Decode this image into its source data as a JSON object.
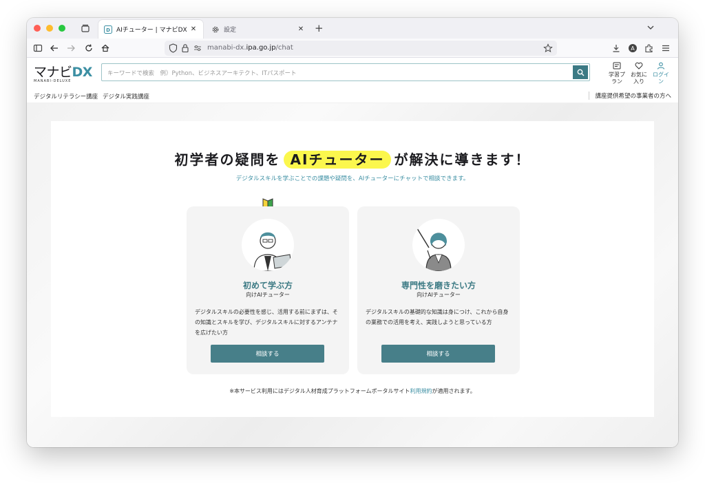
{
  "browser": {
    "tabs": [
      {
        "title": "AIチューター | マナビDX",
        "active": true
      },
      {
        "title": "設定",
        "active": false
      }
    ],
    "url": {
      "prefix": "manabi-dx.",
      "domain": "ipa.go.jp",
      "path": "/chat"
    }
  },
  "site": {
    "logo": {
      "main": "マナビ",
      "dx": "DX",
      "sub": "MANABI-DELUXE"
    },
    "search_placeholder": "キーワードで検索　例）Python、ビジネスアーキテクト、ITパスポート",
    "header_items": [
      {
        "label1": "学習プ",
        "label2": "ラン",
        "icon": "plan-icon"
      },
      {
        "label1": "お気に",
        "label2": "入り",
        "icon": "heart-icon"
      },
      {
        "label1": "ログイ",
        "label2": "ン",
        "icon": "user-icon"
      }
    ],
    "subnav": [
      "デジタルリテラシー講座",
      "デジタル実践講座"
    ],
    "subnav_right": "講座提供希望の事業者の方へ"
  },
  "main": {
    "headline_before": "初学者の疑問を",
    "headline_highlight": "AIチューター",
    "headline_after": "が解決に導きます！",
    "subline": "デジタルスキルを学ぶことでの課題や疑問を、AIチューターにチャットで相談できます。",
    "cards": [
      {
        "title": "初めて学ぶ方",
        "subtitle": "向けAIチューター",
        "description": "デジタルスキルの必要性を感じ、活用する前にまずは、その知識とスキルを学び、デジタルスキルに対するアンテナを広げたい方",
        "button": "相談する"
      },
      {
        "title": "専門性を磨きたい方",
        "subtitle": "向けAIチューター",
        "description": "デジタルスキルの基礎的な知識は身につけ、これから自身の業務での活用を考え、実践しようと思っている方",
        "button": "相談する"
      }
    ],
    "footnote_before": "※本サービス利用にはデジタル人材育成プラットフォームポータルサイト",
    "footnote_link": "利用規約",
    "footnote_after": "が適用されます。"
  },
  "colors": {
    "accent": "#3c8fa3",
    "button": "#477f89",
    "highlight": "#fbf74d"
  }
}
